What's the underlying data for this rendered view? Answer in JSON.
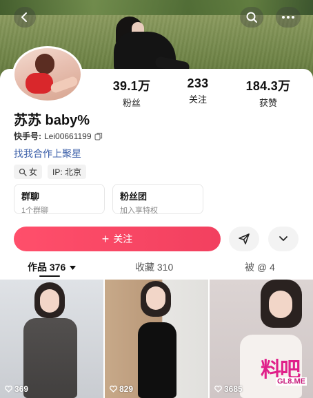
{
  "profile": {
    "name": "苏苏 baby%",
    "uid_label": "快手号:",
    "uid_value": "Lei00661199",
    "bio": "找我合作上聚星",
    "tags": [
      {
        "icon": "search-person-icon",
        "label": "女"
      },
      {
        "icon": "",
        "label": "IP: 北京"
      }
    ]
  },
  "stats": {
    "fans": {
      "value": "39.1万",
      "label": "粉丝"
    },
    "following": {
      "value": "233",
      "label": "关注"
    },
    "likes": {
      "value": "184.3万",
      "label": "获赞"
    }
  },
  "cards": {
    "group": {
      "title": "群聊",
      "sub": "1个群聊"
    },
    "fans_club": {
      "title": "粉丝团",
      "sub": "加入享特权"
    }
  },
  "actions": {
    "follow_label": "关注",
    "follow_prefix": "+"
  },
  "tabs": [
    {
      "label": "作品 376"
    },
    {
      "label": "收藏 310"
    },
    {
      "label": "被 @ 4"
    }
  ],
  "videos": [
    {
      "count": "369"
    },
    {
      "count": "829"
    },
    {
      "count": "3685"
    }
  ],
  "watermark": {
    "big": "料吧",
    "small": "GL8.ME"
  },
  "colors": {
    "accent": "#f2405f",
    "link": "#3a5ea8"
  }
}
